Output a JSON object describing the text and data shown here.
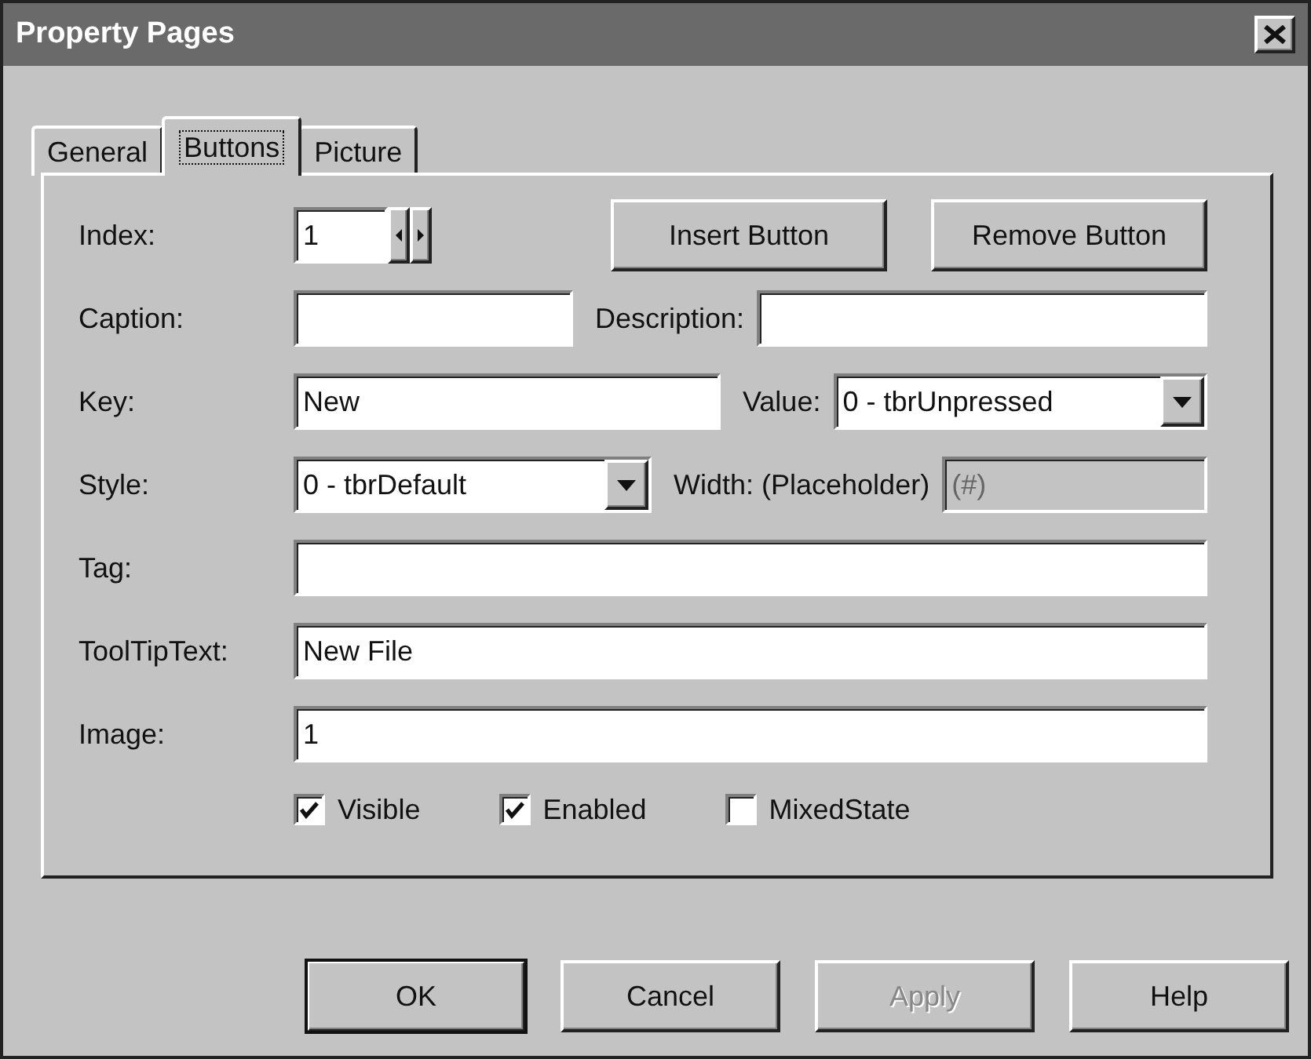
{
  "window": {
    "title": "Property Pages"
  },
  "tabs": [
    {
      "label": "General",
      "selected": false
    },
    {
      "label": "Buttons",
      "selected": true
    },
    {
      "label": "Picture",
      "selected": false
    }
  ],
  "rows": [
    [
      {
        "kind": "label",
        "text": "Index:"
      },
      {
        "kind": "spin",
        "value": "1"
      },
      {
        "kind": "gap"
      },
      {
        "kind": "button",
        "text": "Insert Button",
        "disabled": false
      },
      {
        "kind": "button",
        "text": "Remove Button",
        "disabled": false
      }
    ],
    [
      {
        "kind": "label",
        "text": "Caption:"
      },
      {
        "kind": "field",
        "disabled": false
      },
      {
        "kind": "label",
        "text": "Description:"
      },
      {
        "kind": "field",
        "disabled": false
      }
    ],
    [
      {
        "kind": "label",
        "text": "Key:"
      },
      {
        "kind": "field",
        "value": "New",
        "disabled": false
      },
      {
        "kind": "label",
        "text": "Value:"
      },
      {
        "kind": "combo",
        "value": "0 - tbrUnpressed"
      }
    ],
    [
      {
        "kind": "label",
        "text": "Style:"
      },
      {
        "kind": "combo",
        "value": "0 - tbrDefault"
      },
      {
        "kind": "label",
        "text": "Width: (Placeholder)"
      },
      {
        "kind": "field",
        "value": "(#)",
        "disabled": true
      }
    ],
    [
      {
        "kind": "label",
        "text": "Tag:"
      },
      {
        "kind": "field",
        "disabled": false
      }
    ],
    [
      {
        "kind": "label",
        "text": "ToolTipText:"
      },
      {
        "kind": "field",
        "value": "New File",
        "disabled": false
      }
    ],
    [
      {
        "kind": "label",
        "text": "Image:"
      },
      {
        "kind": "field",
        "value": "1",
        "disabled": false
      }
    ]
  ],
  "checkboxes": [
    {
      "label": "Visible",
      "checked": true
    },
    {
      "label": "Enabled",
      "checked": true
    },
    {
      "label": "MixedState",
      "checked": false
    }
  ],
  "buttons": [
    {
      "label": "OK",
      "default": true,
      "disabled": false
    },
    {
      "label": "Cancel",
      "default": false,
      "disabled": false
    },
    {
      "label": "Apply",
      "default": false,
      "disabled": true
    },
    {
      "label": "Help",
      "default": false,
      "disabled": false
    }
  ]
}
